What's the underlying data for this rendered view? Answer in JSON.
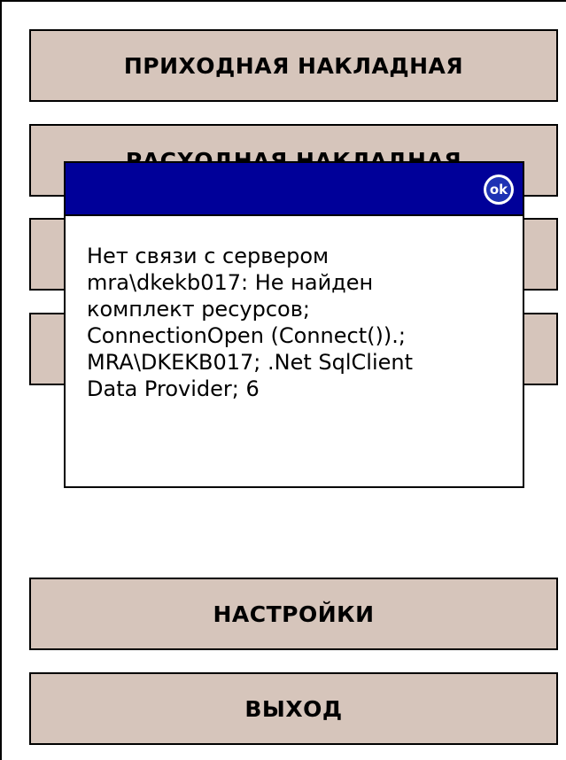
{
  "menu": {
    "incoming_invoice": "ПРИХОДНАЯ НАКЛАДНАЯ",
    "outgoing_invoice": "РАСХОДНАЯ НАКЛАДНАЯ",
    "settings": "НАСТРОЙКИ",
    "exit": "ВЫХОД"
  },
  "dialog": {
    "ok_label": "ok",
    "message_lines": [
      "Нет связи с сервером",
      "mra\\dkekb017: Не найден",
      "комплект ресурсов;",
      "ConnectionOpen (Connect()).;",
      "MRA\\DKEKB017; .Net SqlClient",
      "Data Provider; 6"
    ]
  },
  "colors": {
    "button_background": "#d6c5bb",
    "dialog_titlebar": "#000099",
    "ok_badge": "#1e32b4",
    "background": "#ffffff"
  }
}
